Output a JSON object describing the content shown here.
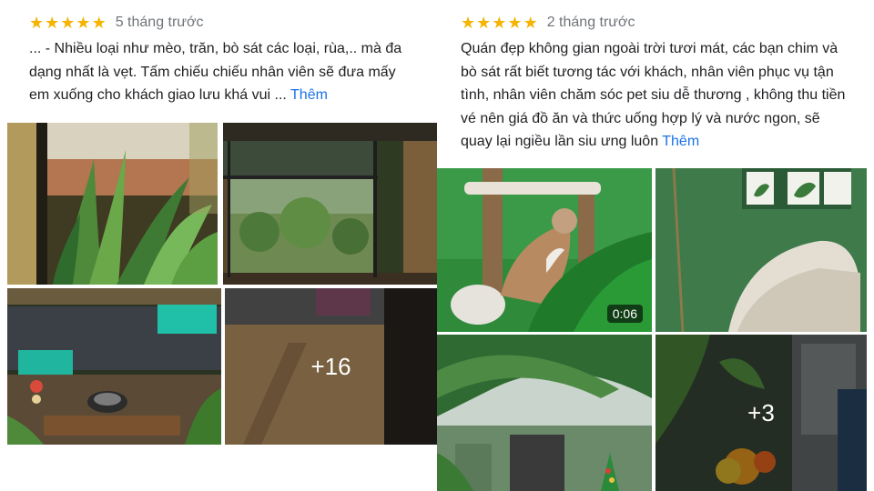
{
  "left_review": {
    "stars": 5,
    "time": "5 tháng trước",
    "text": "... - Nhiều loại như mèo, trăn, bò sát các loại, rùa,.. mà đa dạng nhất là vẹt. Tấm chiếu chiếu nhân viên sẽ đưa mấy em xuống cho khách giao lưu khá vui ...",
    "more_label": "Thêm",
    "photos": {
      "more_count": "+16"
    }
  },
  "right_review": {
    "stars": 5,
    "time": "2 tháng trước",
    "text": "Quán đẹp không gian ngoài trời tươi mát, các bạn chim và bò sát rất biết tương tác với khách, nhân viên phục vụ tận tình, nhân viên chăm sóc pet siu dễ thương , không thu tiền vé nên giá đồ ăn và thức uống hợp lý và nước ngon, sẽ quay lại ngiều lần siu ưng luôn",
    "more_label": "Thêm",
    "photos": {
      "video_duration": "0:06",
      "more_count": "+3"
    }
  },
  "colors": {
    "star": "#f6b400",
    "link": "#1a73e8",
    "time": "#70757a"
  }
}
